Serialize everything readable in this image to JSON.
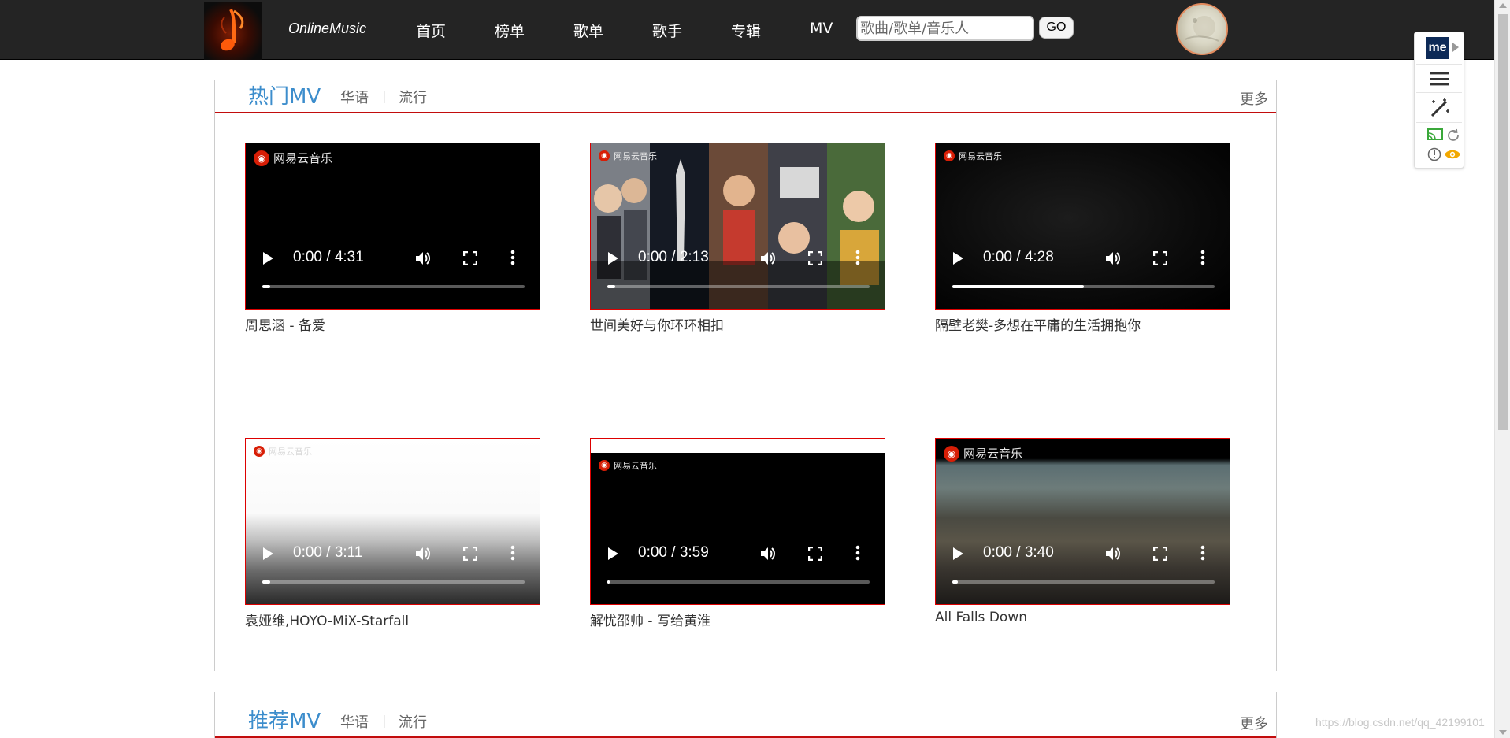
{
  "nav": {
    "brand": "OnlineMusic",
    "items": [
      {
        "label": "首页"
      },
      {
        "label": "榜单"
      },
      {
        "label": "歌单"
      },
      {
        "label": "歌手"
      },
      {
        "label": "专辑"
      },
      {
        "label": "MV"
      }
    ],
    "search_placeholder": "歌曲/歌单/音乐人",
    "go_label": "GO"
  },
  "sections": [
    {
      "title": "热门MV",
      "tags": [
        "华语",
        "流行"
      ],
      "separator": "|",
      "more": "更多",
      "videos": [
        {
          "caption": "周思涵 - 备爱",
          "time": "0:00 / 4:31",
          "watermark": "网易云音乐",
          "progress": 0.03
        },
        {
          "caption": "世间美好与你环环相扣",
          "time": "0:00 / 2:13",
          "watermark": "网易云音乐",
          "progress": 0.03
        },
        {
          "caption": "隔壁老樊-多想在平庸的生活拥抱你",
          "time": "0:00 / 4:28",
          "watermark": "网易云音乐",
          "progress": 0.5
        },
        {
          "caption": "袁娅维,HOYO-MiX-Starfall",
          "time": "0:00 / 3:11",
          "watermark": "网易云音乐",
          "progress": 0.03
        },
        {
          "caption": "解忧邵帅 - 写给黄淮",
          "time": "0:00 / 3:59",
          "watermark": "网易云音乐",
          "progress": 0.01
        },
        {
          "caption": "All Falls Down",
          "time": "0:00 / 3:40",
          "watermark": "网易云音乐",
          "progress": 0.02
        }
      ]
    },
    {
      "title": "推荐MV",
      "tags": [
        "华语",
        "流行"
      ],
      "separator": "|",
      "more": "更多"
    }
  ],
  "extension": {
    "me_label": "me"
  },
  "watermark_url": "https://blog.csdn.net/qq_42199101",
  "colors": {
    "accent_red": "#c20c0c",
    "title_blue": "#3c8dcc",
    "nav_bg": "#242424"
  }
}
